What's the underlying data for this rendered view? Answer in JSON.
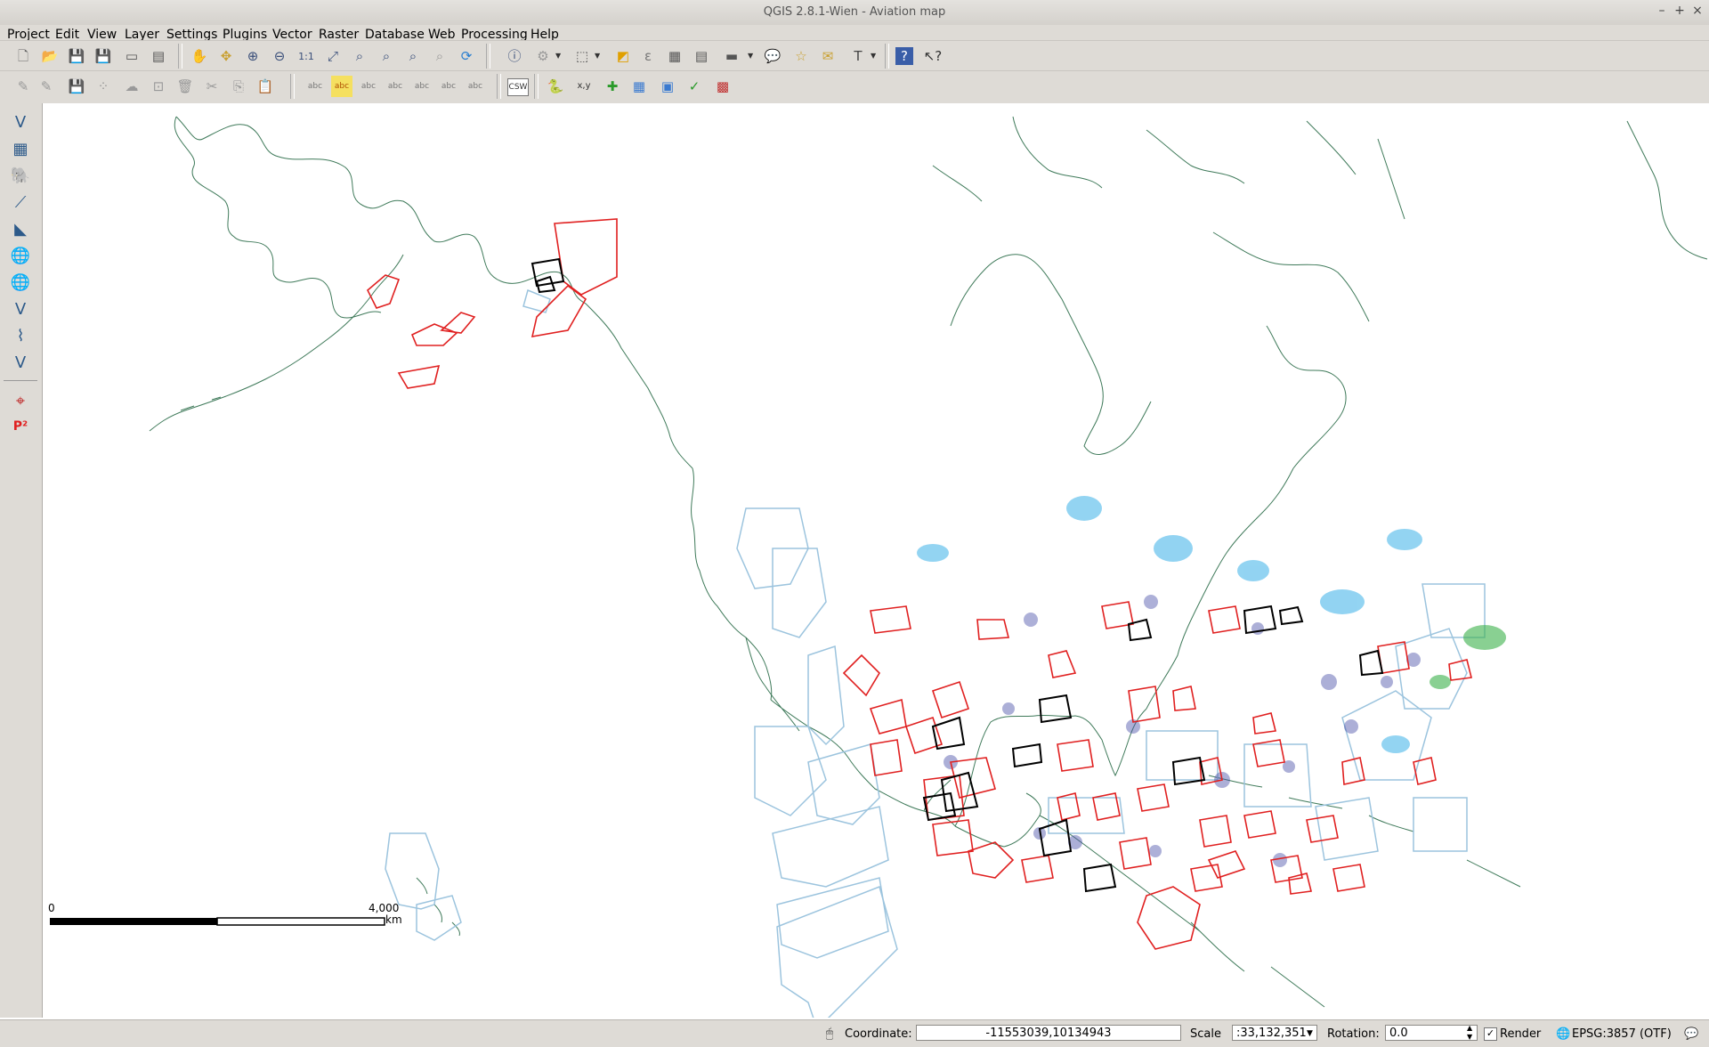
{
  "window": {
    "title": "QGIS 2.8.1-Wien - Aviation map",
    "minimize": "–",
    "maximize": "+",
    "close": "×"
  },
  "menubar": {
    "items": [
      "Project",
      "Edit",
      "View",
      "Layer",
      "Settings",
      "Plugins",
      "Vector",
      "Raster",
      "Database",
      "Web",
      "Processing",
      "Help"
    ]
  },
  "toolbar": {
    "csw_label": "CSW",
    "xy_label": "x,y",
    "abc_label": "abc"
  },
  "sidebar": {
    "p2_label": "P²"
  },
  "map": {
    "scalebar": {
      "start_label": "0",
      "end_label": "4,000",
      "unit_label": "km"
    }
  },
  "statusbar": {
    "coordinate_label": "Coordinate:",
    "coordinate_value": "-11553039,10134943",
    "scale_label": "Scale",
    "scale_value": ":33,132,351",
    "rotation_label": "Rotation:",
    "rotation_value": "0.0",
    "render_label": "Render",
    "render_checked": true,
    "crs_label": "EPSG:3857 (OTF)"
  },
  "colors": {
    "coastline": "#3f7a5a",
    "restricted_airspace": "#e02020",
    "military_zone": "#000000",
    "offshore_zone": "#9cc4de",
    "airport_marker": "#4a4fa8",
    "weather_overlay": "#3ab0e8"
  }
}
